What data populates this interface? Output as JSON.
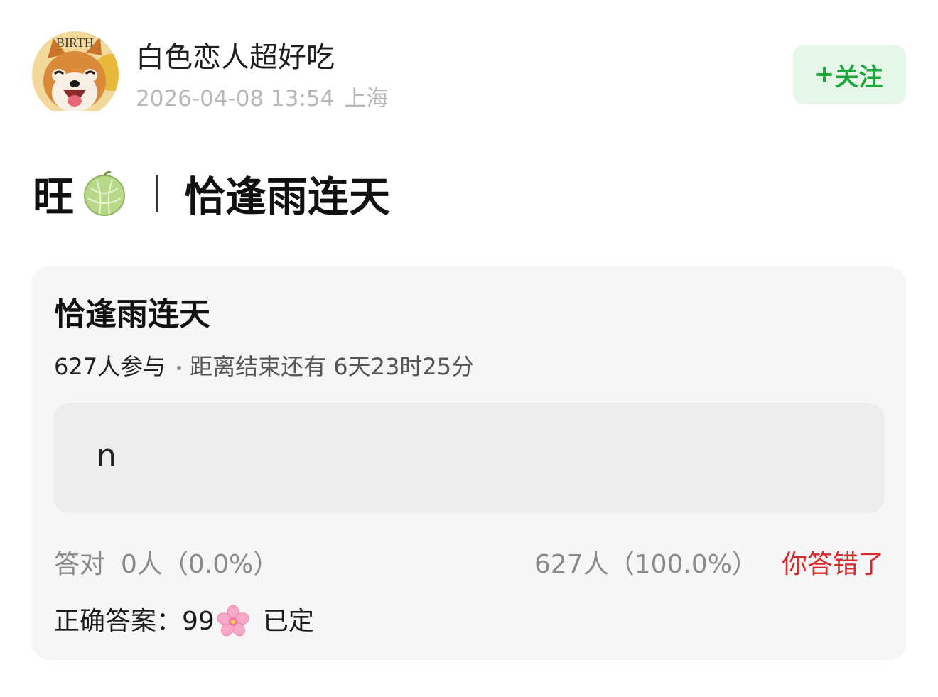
{
  "author": {
    "name": "白色恋人超好吃",
    "date": "2026-04-08 13:54",
    "location": "上海",
    "avatar_icon": "shiba-dog-avatar",
    "avatar_text": "BIRTH"
  },
  "follow_button": {
    "label": "关注",
    "icon": "plus-icon",
    "color": "#1ca63c",
    "background": "#e6f6e9"
  },
  "post": {
    "title_prefix": "旺",
    "title_prefix_icon": "melon-icon",
    "title_main": "恰逢雨连天"
  },
  "quiz": {
    "title": "恰逢雨连天",
    "participants": "627人参与",
    "countdown": "距离结束还有 6天23时25分",
    "option_text": "n",
    "correct_label": "答对",
    "correct_value": "0人（0.0%）",
    "wrong_value": "627人（100.0%）",
    "wrong_label": "你答错了",
    "wrong_color": "#d42b2b",
    "answer_label": "正确答案：",
    "answer_value": "99",
    "answer_icon": "cherry-blossom-icon",
    "answer_status": "已定"
  }
}
